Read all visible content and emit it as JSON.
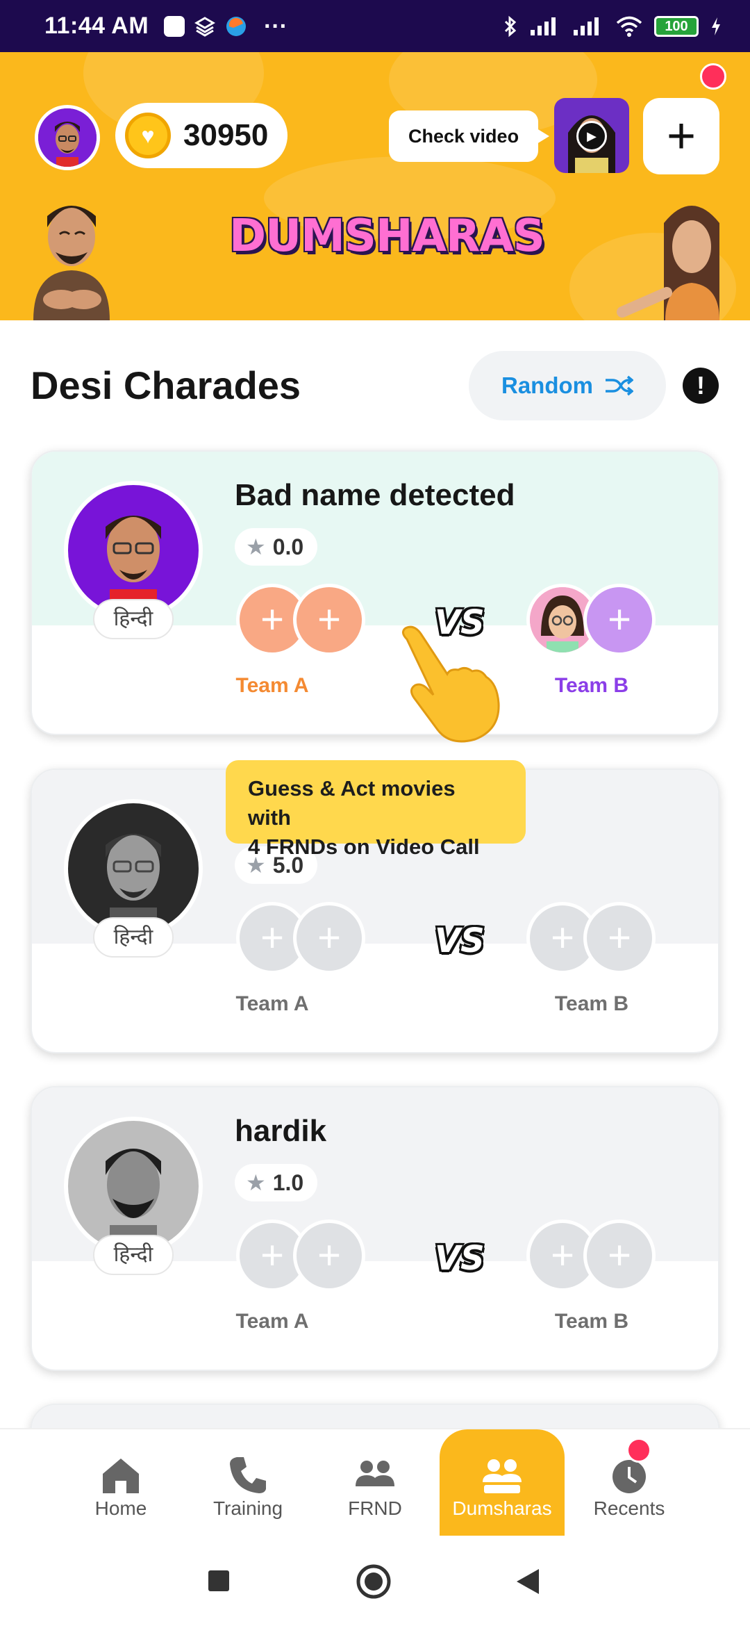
{
  "status_bar": {
    "time": "11:44 AM",
    "battery": "100"
  },
  "header": {
    "coins": "30950",
    "check_video_label": "Check video",
    "logo_text": "DUMSHARAS"
  },
  "title_row": {
    "title": "Desi Charades",
    "random_label": "Random",
    "info_symbol": "!"
  },
  "cards": [
    {
      "name": "Bad name detected",
      "rating": "0.0",
      "language": "हिन्दी",
      "team_a": "Team A",
      "team_b": "Team B",
      "vs": "VS"
    },
    {
      "name": "",
      "rating": "5.0",
      "language": "हिन्दी",
      "team_a": "Team A",
      "team_b": "Team B",
      "vs": "VS"
    },
    {
      "name": "hardik",
      "rating": "1.0",
      "language": "हिन्दी",
      "team_a": "Team A",
      "team_b": "Team B",
      "vs": "VS"
    }
  ],
  "tooltip": {
    "line1": "Guess & Act movies with",
    "line2": "4 FRNDs on Video Call"
  },
  "bottom_nav": {
    "items": [
      {
        "label": "Home",
        "icon": "home-icon"
      },
      {
        "label": "Training",
        "icon": "phone-icon"
      },
      {
        "label": "FRND",
        "icon": "friends-icon"
      },
      {
        "label": "Dumsharas",
        "icon": "group-icon"
      },
      {
        "label": "Recents",
        "icon": "clock-icon"
      }
    ],
    "active": "Dumsharas"
  },
  "colors": {
    "header_bg": "#fbb81c",
    "team_a_active": "#f48a32",
    "team_b_active": "#8b3ee8",
    "random_text": "#1a8fe0",
    "tooltip_bg": "#ffd84d",
    "notification_dot": "#ff2f5a"
  }
}
